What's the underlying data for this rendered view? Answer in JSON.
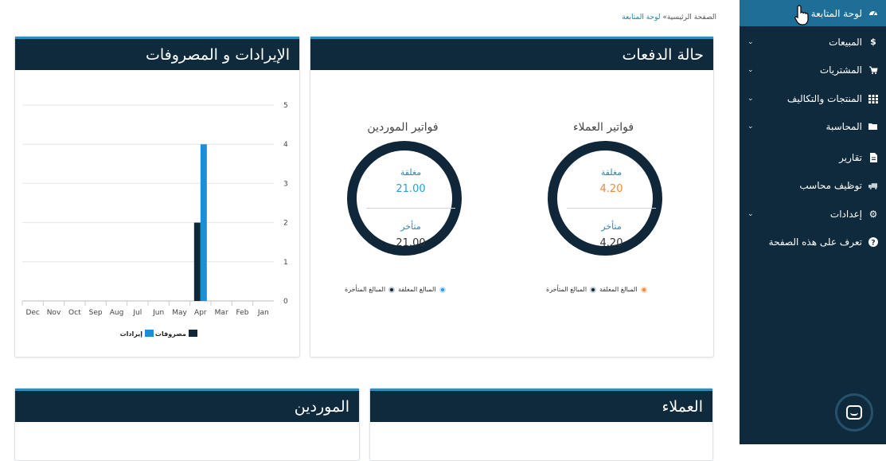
{
  "sidebar": {
    "items": [
      {
        "label": "لوحة المتابعة",
        "icon": "dashboard-icon",
        "active": true,
        "chevron": false
      },
      {
        "label": "المبيعات",
        "icon": "dollar-icon",
        "active": false,
        "chevron": true
      },
      {
        "label": "المشتريات",
        "icon": "cart-icon",
        "active": false,
        "chevron": true
      },
      {
        "label": "المنتجات والتكاليف",
        "icon": "grid-icon",
        "active": false,
        "chevron": true
      },
      {
        "label": "المحاسبة",
        "icon": "folder-icon",
        "active": false,
        "chevron": true
      },
      {
        "label": "تقارير",
        "icon": "document-icon",
        "active": false,
        "chevron": false
      },
      {
        "label": "توظيف محاسب",
        "icon": "truck-icon",
        "active": false,
        "chevron": false
      },
      {
        "label": "إعدادات",
        "icon": "gear-icon",
        "active": false,
        "chevron": true
      },
      {
        "label": "تعرف على هذه الصفحة",
        "icon": "help-icon",
        "active": false,
        "chevron": false
      }
    ]
  },
  "breadcrumb": {
    "home": "الصفحة الرئيسية",
    "separator": "»",
    "current": "لوحة المتابعة"
  },
  "payments_panel": {
    "title": "حالة الدفعات",
    "customers": {
      "title": "فواتير العملاء",
      "closed_label": "مغلقة",
      "closed_value": "4.20",
      "closed_color": "#f0883a",
      "late_label": "متأخر",
      "late_value": "4.20",
      "legend_closed": "المبالغ المغلقة",
      "legend_late": "المبالغ المتأخرة"
    },
    "suppliers": {
      "title": "فواتير الموردين",
      "closed_label": "مغلقة",
      "closed_value": "21.00",
      "closed_color": "#2e9be0",
      "late_label": "متأخر",
      "late_value": "21.00",
      "legend_closed": "المبالغ المغلقة",
      "legend_late": "المبالغ المتأخرة"
    }
  },
  "revenue_panel": {
    "title": "الإيرادات و المصروفات"
  },
  "chart_data": {
    "type": "bar",
    "categories": [
      "Jan",
      "Feb",
      "Mar",
      "Apr",
      "May",
      "Jun",
      "Jul",
      "Aug",
      "Sep",
      "Oct",
      "Nov",
      "Dec"
    ],
    "series": [
      {
        "name": "مصروفات",
        "color": "#10273a",
        "values": [
          0,
          0,
          0,
          2,
          0,
          0,
          0,
          0,
          0,
          0,
          0,
          0
        ]
      },
      {
        "name": "إيرادات",
        "color": "#1a8fd8",
        "values": [
          0,
          0,
          0,
          4,
          0,
          0,
          0,
          0,
          0,
          0,
          0,
          0
        ]
      }
    ],
    "ylim": [
      0,
      5
    ],
    "yticks": [
      "0",
      "1",
      "2",
      "3",
      "4",
      "5"
    ],
    "x_reversed": true,
    "legend_position": "bottom",
    "grid": true
  },
  "customers_panel": {
    "title": "العملاء"
  },
  "suppliers_panel": {
    "title": "الموردين"
  }
}
